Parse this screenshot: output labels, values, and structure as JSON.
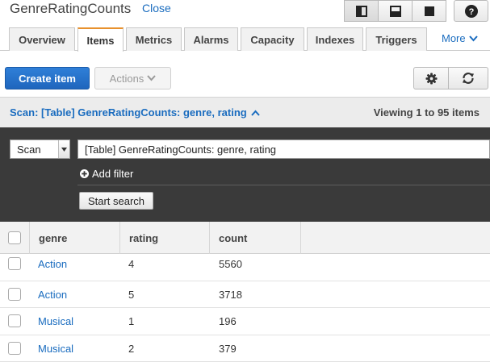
{
  "header": {
    "title": "GenreRatingCounts",
    "close_label": "Close"
  },
  "tabs": [
    {
      "label": "Overview",
      "active": false
    },
    {
      "label": "Items",
      "active": true
    },
    {
      "label": "Metrics",
      "active": false
    },
    {
      "label": "Alarms",
      "active": false
    },
    {
      "label": "Capacity",
      "active": false
    },
    {
      "label": "Indexes",
      "active": false
    },
    {
      "label": "Triggers",
      "active": false
    }
  ],
  "more_label": "More",
  "toolbar": {
    "create_label": "Create item",
    "actions_label": "Actions"
  },
  "scan": {
    "summary": "Scan: [Table] GenreRatingCounts: genre, rating",
    "viewing": "Viewing 1 to 95 items",
    "mode_value": "Scan",
    "source_value": "[Table] GenreRatingCounts: genre, rating",
    "add_filter_label": "Add filter",
    "start_search_label": "Start search"
  },
  "table": {
    "columns": [
      "genre",
      "rating",
      "count"
    ],
    "rows": [
      {
        "genre": "Action",
        "rating": "4",
        "count": "5560"
      },
      {
        "genre": "Action",
        "rating": "5",
        "count": "3718"
      },
      {
        "genre": "Musical",
        "rating": "1",
        "count": "196"
      },
      {
        "genre": "Musical",
        "rating": "2",
        "count": "379"
      }
    ]
  },
  "colors": {
    "primary_button": "#2a77d2",
    "link": "#1a6cbf",
    "active_tab_accent": "#e8912d",
    "search_panel_bg": "#3a3a3a"
  },
  "icons": [
    "split-view-icon",
    "bottom-panel-icon",
    "full-view-icon",
    "help-icon",
    "chevron-down-icon",
    "gear-icon",
    "refresh-icon",
    "chevron-up-icon",
    "plus-circle-icon"
  ]
}
